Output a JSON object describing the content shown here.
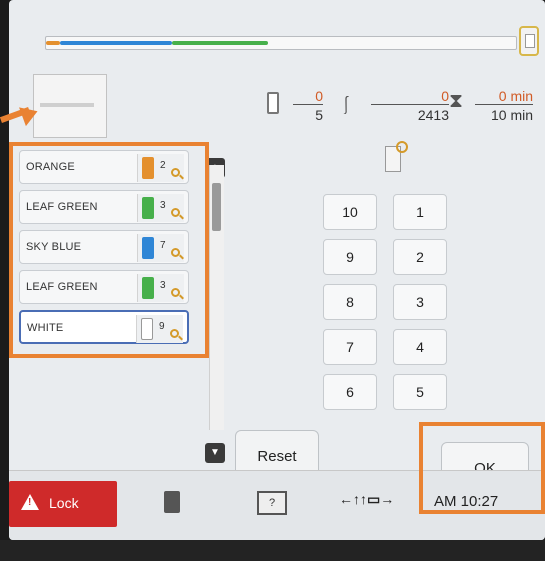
{
  "progress": {
    "segments": [
      {
        "color": "#e4902e",
        "fraction": 0.03
      },
      {
        "color": "#2f86d6",
        "fraction": 0.24
      },
      {
        "color": "#47b04b",
        "fraction": 0.2
      }
    ]
  },
  "colors": [
    {
      "name": "ORANGE",
      "spool_color": "#e4902e",
      "order": "2",
      "selected": false
    },
    {
      "name": "LEAF GREEN",
      "spool_color": "#47b04b",
      "order": "3",
      "selected": false
    },
    {
      "name": "SKY BLUE",
      "spool_color": "#2f86d6",
      "order": "7",
      "selected": false
    },
    {
      "name": "LEAF GREEN",
      "spool_color": "#47b04b",
      "order": "3",
      "selected": false
    },
    {
      "name": "WHITE",
      "spool_color": "#ffffff",
      "order": "9",
      "selected": true
    }
  ],
  "stats": {
    "color_current": "0",
    "color_total": "5",
    "stitch_current": "0",
    "stitch_total": "2413",
    "time_current": "0",
    "time_unit_current": "min",
    "time_total": "10",
    "time_unit_total": "min"
  },
  "keypad": {
    "left": [
      "10",
      "9",
      "8",
      "7",
      "6"
    ],
    "right": [
      "1",
      "2",
      "3",
      "4",
      "5"
    ]
  },
  "buttons": {
    "reset": "Reset",
    "ok": "OK",
    "lock": "Lock"
  },
  "status": {
    "clock": "AM 10:27",
    "help_icon": "help-icon",
    "feed_icon": "←↑↑▭→"
  }
}
